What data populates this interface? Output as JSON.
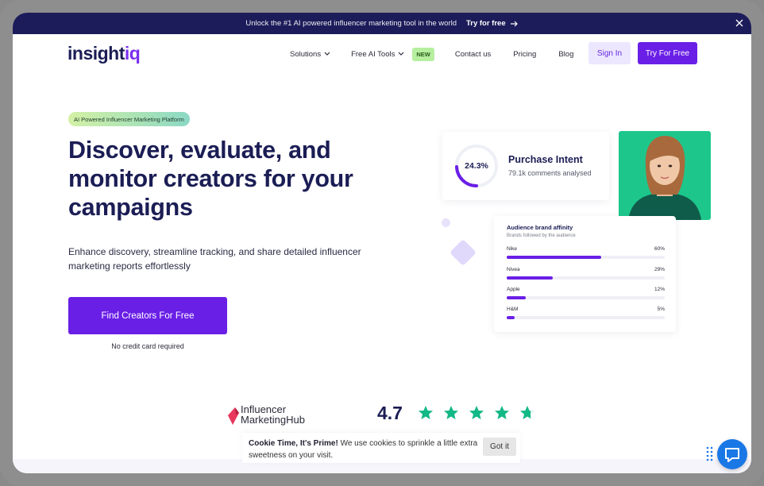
{
  "announcement": {
    "message": "Unlock the #1 AI powered influencer marketing tool in the world",
    "cta": "Try for free",
    "cta_icon": "arrow-right-icon",
    "close_icon": "close-icon"
  },
  "brand": {
    "logo_part1": "insight",
    "logo_part2": "iq"
  },
  "nav": {
    "items": [
      {
        "label": "Solutions",
        "dropdown": true
      },
      {
        "label": "Free AI Tools",
        "dropdown": true,
        "badge": "NEW"
      },
      {
        "label": "Contact us"
      },
      {
        "label": "Pricing"
      },
      {
        "label": "Blog"
      }
    ],
    "signin": "Sign In",
    "try_free": "Try For Free"
  },
  "hero": {
    "pill": "AI Powered Influencer Marketing Platform",
    "headline": "Discover, evaluate, and monitor creators for your campaigns",
    "subtext": "Enhance discovery, streamline tracking, and share detailed influencer marketing reports effortlessly",
    "cta": "Find Creators For Free",
    "note": "No credit card required"
  },
  "purchase_intent": {
    "percent": "24.3%",
    "percent_value": 24.3,
    "title": "Purchase Intent",
    "subtitle": "79.1k comments analysed"
  },
  "affinity": {
    "title": "Audience brand affinity",
    "subtitle": "Brands followed by the audience",
    "brands": [
      {
        "name": "Nike",
        "value": "60%",
        "pct": 60
      },
      {
        "name": "Nivea",
        "value": "29%",
        "pct": 29
      },
      {
        "name": "Apple",
        "value": "12%",
        "pct": 12
      },
      {
        "name": "H&M",
        "value": "5%",
        "pct": 5
      }
    ]
  },
  "review": {
    "source_line1": "Influencer",
    "source_line2": "MarketingHub",
    "score": "4.7",
    "stars": 4.7,
    "star_color": "#12b886"
  },
  "cookie": {
    "bold": "Cookie Time, It's Prime!",
    "text": " We use cookies to sprinkle a little extra sweetness on your visit.",
    "button": "Got it"
  },
  "colors": {
    "primary": "#6a1fe6",
    "navy": "#1b1d55",
    "photo_bg": "#1dc78c",
    "chat": "#1a78e6"
  }
}
